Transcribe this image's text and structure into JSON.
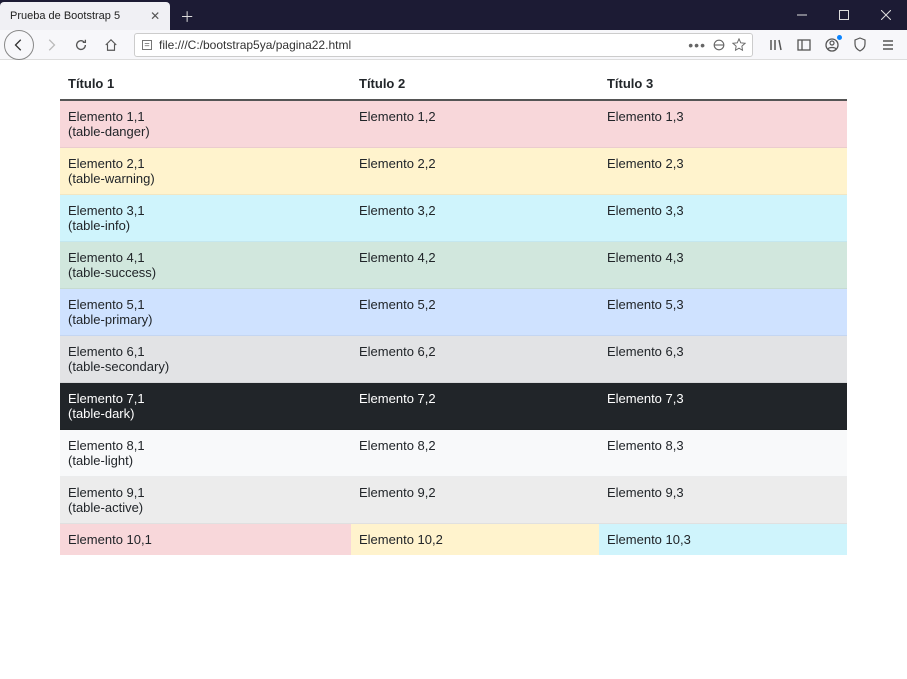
{
  "window": {
    "tab_title": "Prueba de Bootstrap 5",
    "url": "file:///C:/bootstrap5ya/pagina22.html",
    "url_actions_more": "•••"
  },
  "table": {
    "headers": [
      "Título 1",
      "Título 2",
      "Título 3"
    ],
    "rows": [
      {
        "class": "table-danger",
        "cells": [
          "Elemento 1,1\n(table-danger)",
          "Elemento 1,2",
          "Elemento 1,3"
        ]
      },
      {
        "class": "table-warning",
        "cells": [
          "Elemento 2,1\n(table-warning)",
          "Elemento 2,2",
          "Elemento 2,3"
        ]
      },
      {
        "class": "table-info",
        "cells": [
          "Elemento 3,1\n(table-info)",
          "Elemento 3,2",
          "Elemento 3,3"
        ]
      },
      {
        "class": "table-success",
        "cells": [
          "Elemento 4,1\n(table-success)",
          "Elemento 4,2",
          "Elemento 4,3"
        ]
      },
      {
        "class": "table-primary",
        "cells": [
          "Elemento 5,1\n(table-primary)",
          "Elemento 5,2",
          "Elemento 5,3"
        ]
      },
      {
        "class": "table-secondary",
        "cells": [
          "Elemento 6,1\n(table-secondary)",
          "Elemento 6,2",
          "Elemento 6,3"
        ]
      },
      {
        "class": "table-dark",
        "cells": [
          "Elemento 7,1\n(table-dark)",
          "Elemento 7,2",
          "Elemento 7,3"
        ]
      },
      {
        "class": "table-light",
        "cells": [
          "Elemento 8,1\n(table-light)",
          "Elemento 8,2",
          "Elemento 8,3"
        ]
      },
      {
        "class": "table-active",
        "cells": [
          "Elemento 9,1\n(table-active)",
          "Elemento 9,2",
          "Elemento 9,3"
        ]
      },
      {
        "cell_classes": [
          "cell-danger",
          "cell-warning",
          "cell-info"
        ],
        "cells": [
          "Elemento 10,1",
          "Elemento 10,2",
          "Elemento 10,3"
        ]
      }
    ]
  }
}
